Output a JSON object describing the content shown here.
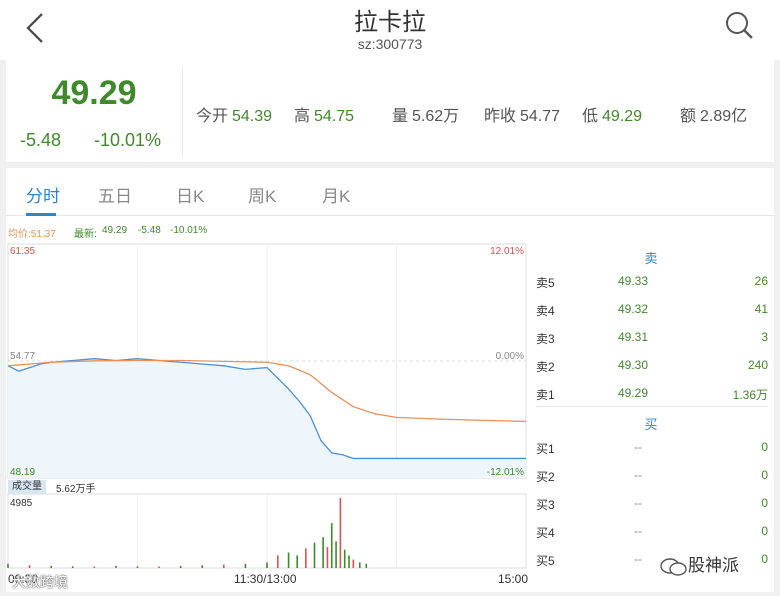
{
  "header": {
    "title": "拉卡拉",
    "code": "sz:300773"
  },
  "quote": {
    "price": "49.29",
    "change": "-5.48",
    "change_pct": "-10.01%",
    "stats": [
      {
        "label": "今开",
        "value": "54.39",
        "color": "green"
      },
      {
        "label": "高",
        "value": "54.75",
        "color": "green"
      },
      {
        "label": "量",
        "value": "5.62万",
        "color": "neutral"
      },
      {
        "label": "昨收",
        "value": "54.77",
        "color": "neutral"
      },
      {
        "label": "低",
        "value": "49.29",
        "color": "green"
      },
      {
        "label": "额",
        "value": "2.89亿",
        "color": "neutral"
      }
    ]
  },
  "tabs": [
    "分时",
    "五日",
    "日K",
    "周K",
    "月K"
  ],
  "active_tab": "分时",
  "legend": {
    "avg": "均价:51.37",
    "latest_label": "最新:",
    "latest": "49.29",
    "chg": "-5.48",
    "pct": "-10.01%"
  },
  "chart_axes": {
    "y_left_top": "61.35",
    "y_left_mid": "54.77",
    "y_left_bottom": "48.19",
    "y_right_top": "12.01%",
    "y_right_mid": "0.00%",
    "y_right_bottom": "-12.01%",
    "x_start": "09:30",
    "x_mid": "11:30/13:00",
    "x_end": "15:00",
    "vol_label": "成交量",
    "vol_unit": "5.62万手",
    "vol_max": "4985"
  },
  "chart_data": {
    "type": "line",
    "ylim": [
      48.19,
      61.35
    ],
    "prev_close": 54.77,
    "x_range_minutes": [
      0,
      240
    ],
    "series": [
      {
        "name": "最新",
        "color": "#4a90d9",
        "x": [
          0,
          5,
          10,
          15,
          20,
          30,
          40,
          50,
          60,
          70,
          80,
          90,
          100,
          110,
          120,
          125,
          130,
          135,
          140,
          145,
          150,
          155,
          160,
          170,
          180,
          200,
          220,
          240
        ],
        "y": [
          54.5,
          54.2,
          54.4,
          54.6,
          54.7,
          54.8,
          54.9,
          54.8,
          54.9,
          54.8,
          54.7,
          54.6,
          54.5,
          54.3,
          54.4,
          53.8,
          53.2,
          52.5,
          51.7,
          50.3,
          49.6,
          49.5,
          49.29,
          49.29,
          49.29,
          49.29,
          49.29,
          49.29
        ]
      },
      {
        "name": "均价",
        "color": "#e8915a",
        "x": [
          0,
          10,
          20,
          40,
          60,
          80,
          100,
          120,
          130,
          140,
          150,
          160,
          170,
          180,
          200,
          220,
          240
        ],
        "y": [
          54.5,
          54.6,
          54.7,
          54.78,
          54.8,
          54.8,
          54.75,
          54.7,
          54.5,
          54.0,
          53.0,
          52.2,
          51.8,
          51.6,
          51.5,
          51.43,
          51.37
        ]
      }
    ],
    "volume": {
      "max": 4985,
      "x": [
        0,
        10,
        20,
        30,
        40,
        50,
        60,
        70,
        80,
        90,
        100,
        110,
        120,
        125,
        130,
        134,
        138,
        142,
        146,
        148,
        150,
        152,
        154,
        156,
        158,
        160,
        163,
        166
      ],
      "v": [
        300,
        200,
        150,
        120,
        100,
        150,
        120,
        100,
        150,
        200,
        250,
        300,
        400,
        900,
        1100,
        900,
        1400,
        1800,
        2200,
        1500,
        3200,
        1900,
        4985,
        1300,
        900,
        600,
        400,
        300
      ]
    },
    "order_book": {
      "sell_header": "卖",
      "buy_header": "买",
      "sell": [
        {
          "label": "卖5",
          "price": "49.33",
          "qty": "26"
        },
        {
          "label": "卖4",
          "price": "49.32",
          "qty": "41"
        },
        {
          "label": "卖3",
          "price": "49.31",
          "qty": "3"
        },
        {
          "label": "卖2",
          "price": "49.30",
          "qty": "240"
        },
        {
          "label": "卖1",
          "price": "49.29",
          "qty": "1.36万"
        }
      ],
      "buy": [
        {
          "label": "买1",
          "price": "--",
          "qty": "0"
        },
        {
          "label": "买2",
          "price": "--",
          "qty": "0"
        },
        {
          "label": "买3",
          "price": "--",
          "qty": "0"
        },
        {
          "label": "买4",
          "price": "--",
          "qty": "0"
        },
        {
          "label": "买5",
          "price": "--",
          "qty": "0"
        }
      ]
    }
  },
  "watermarks": {
    "left": "大数跨境",
    "right": "股神派"
  },
  "colors": {
    "green": "#3f8a2a",
    "blue": "#2d86c8",
    "red": "#d9534f",
    "avg_line": "#e8915a",
    "price_line": "#4a90d9"
  }
}
